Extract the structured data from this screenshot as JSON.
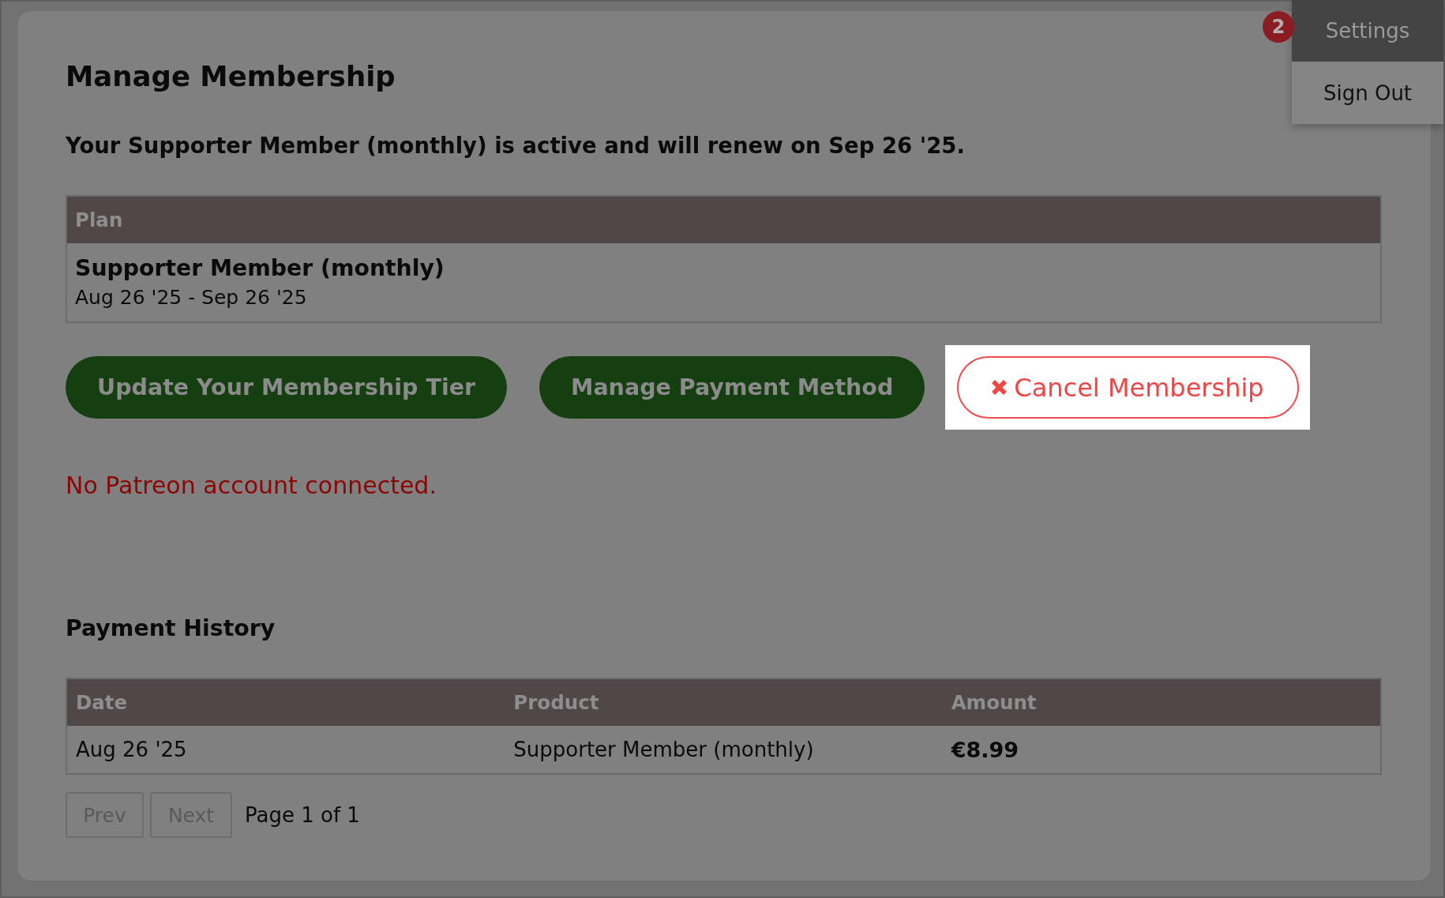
{
  "user_menu": {
    "badge": "2",
    "button": "Settings",
    "items": [
      "Sign Out"
    ]
  },
  "page": {
    "title": "Manage Membership",
    "status": "Your Supporter Member (monthly) is active and will renew on Sep 26 '25.",
    "plan_table": {
      "columns": [
        "Plan"
      ],
      "rows": [
        {
          "name": "Supporter Member (monthly)",
          "period": "Aug 26 '25 - Sep 26 '25"
        }
      ]
    },
    "actions": [
      {
        "label": "Update Your Membership Tier",
        "kind": "primary",
        "highlighted": false
      },
      {
        "label": "Manage Payment Method",
        "kind": "primary",
        "highlighted": false
      },
      {
        "label": "Cancel Membership",
        "kind": "danger",
        "highlighted": true
      }
    ],
    "notice": "No Patreon account connected.",
    "payment_history": {
      "title": "Payment History",
      "columns": [
        {
          "label": "Date",
          "kind": "text"
        },
        {
          "label": "Product",
          "kind": "text"
        },
        {
          "label": "Amount",
          "kind": "money"
        }
      ],
      "rows": [
        [
          "Aug 26 '25",
          "Supporter Member (monthly)",
          "€8.99"
        ]
      ]
    },
    "pagination": {
      "prev": {
        "label": "Prev",
        "disabled": true
      },
      "next": {
        "label": "Next",
        "disabled": true
      },
      "info": "Page 1 of 1"
    }
  }
}
